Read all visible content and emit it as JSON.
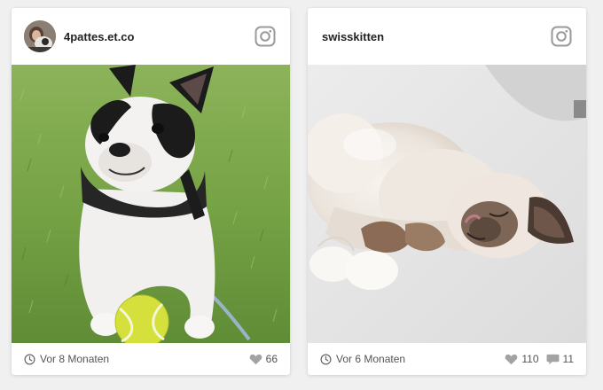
{
  "posts": [
    {
      "username": "4pattes.et.co",
      "has_avatar": true,
      "time_label": "Vor 8 Monaten",
      "likes": "66",
      "comments": null,
      "photo": "french-bulldog-with-tennis-ball-on-grass"
    },
    {
      "username": "swisskitten",
      "has_avatar": false,
      "time_label": "Vor 6 Monaten",
      "likes": "110",
      "comments": "11",
      "photo": "ragdoll-kitten-sleeping-on-carpet"
    }
  ],
  "icons": {
    "platform": "instagram-icon",
    "time": "clock-icon",
    "likes": "heart-icon",
    "comments": "comment-icon"
  },
  "colors": {
    "icon_gray": "#9a9a9a",
    "text": "#222222",
    "muted_text": "#555555"
  }
}
